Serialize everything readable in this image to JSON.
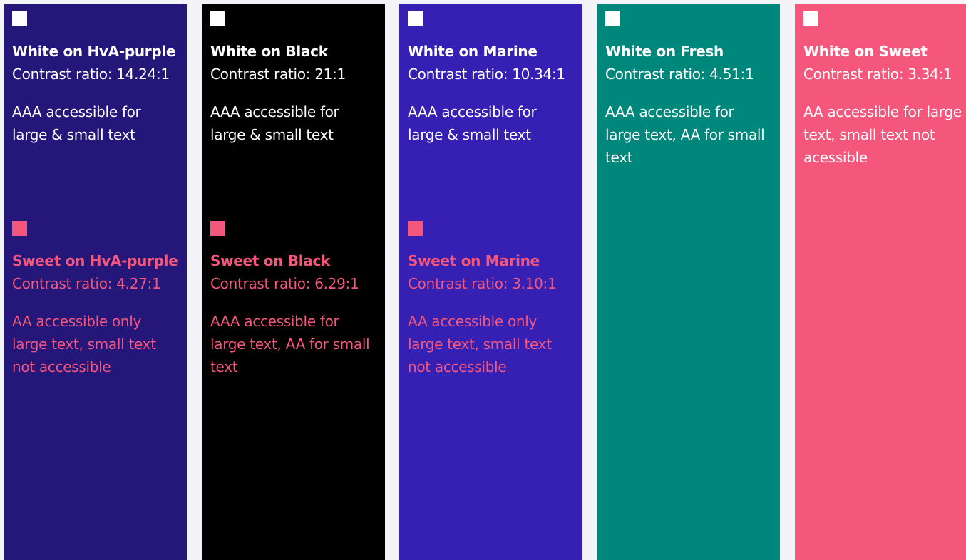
{
  "colors": {
    "hva_purple": "#25167a",
    "black": "#000000",
    "marine": "#3620b4",
    "fresh": "#00877b",
    "sweet": "#f4577b",
    "white": "#ffffff",
    "page_bg": "#f3f3f8"
  },
  "panels": [
    {
      "background": "#25167a",
      "blocks": [
        {
          "swatch": "#ffffff",
          "text_color": "#ffffff",
          "title": "White on HvA-purple",
          "ratio": "Contrast ratio: 14.24:1",
          "desc": "AAA accessible for large & small text"
        },
        {
          "swatch": "#f4577b",
          "text_color": "#f4577b",
          "title": "Sweet on HvA-purple",
          "ratio": "Contrast ratio: 4.27:1",
          "desc": "AA accessible only large text, small text not accessible"
        }
      ]
    },
    {
      "background": "#000000",
      "blocks": [
        {
          "swatch": "#ffffff",
          "text_color": "#ffffff",
          "title": "White on Black",
          "ratio": "Contrast ratio: 21:1",
          "desc": "AAA accessible for large & small text"
        },
        {
          "swatch": "#f4577b",
          "text_color": "#f4577b",
          "title": "Sweet on Black",
          "ratio": "Contrast ratio: 6.29:1",
          "desc": "AAA accessible for large text, AA for small text"
        }
      ]
    },
    {
      "background": "#3620b4",
      "blocks": [
        {
          "swatch": "#ffffff",
          "text_color": "#ffffff",
          "title": "White on Marine",
          "ratio": "Contrast ratio: 10.34:1",
          "desc": "AAA accessible for large & small text"
        },
        {
          "swatch": "#f4577b",
          "text_color": "#f4577b",
          "title": "Sweet on Marine",
          "ratio": "Contrast ratio: 3.10:1",
          "desc": "AA accessible only large text, small text not accessible"
        }
      ]
    },
    {
      "background": "#00877b",
      "blocks": [
        {
          "swatch": "#ffffff",
          "text_color": "#ffffff",
          "title": "White on Fresh",
          "ratio": "Contrast ratio: 4.51:1",
          "desc": "AAA accessible for large text, AA for small text"
        }
      ]
    },
    {
      "background": "#f4577b",
      "blocks": [
        {
          "swatch": "#ffffff",
          "text_color": "#ffffff",
          "title": "White on Sweet",
          "ratio": "Contrast ratio: 3.34:1",
          "desc": "AA accessible for large text, small text not acessible"
        }
      ]
    }
  ]
}
